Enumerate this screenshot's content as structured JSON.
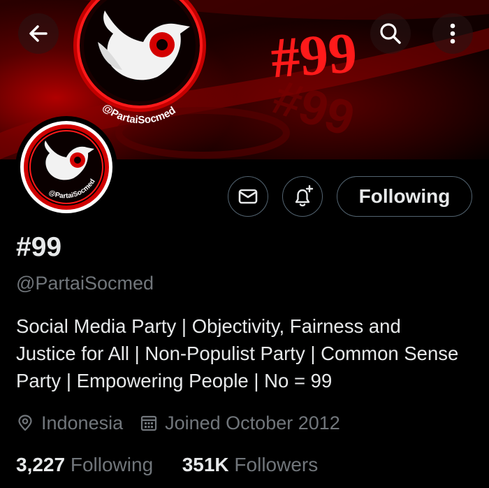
{
  "banner": {
    "hashtag": "#99",
    "echo_text": "#99",
    "logo_caption": "@PartaiSocmed",
    "colors": {
      "accent": "#e00000",
      "dark_red": "#3a0000",
      "background": "#000000"
    }
  },
  "header": {
    "back_icon": "arrow-left-icon",
    "search_icon": "search-icon",
    "more_icon": "more-vertical-icon"
  },
  "avatar": {
    "logo_caption": "@PartaiSocmed"
  },
  "actions": {
    "message_icon": "mail-icon",
    "notify_icon": "bell-plus-icon",
    "following_label": "Following"
  },
  "profile": {
    "display_name": "#99",
    "handle": "@PartaiSocmed",
    "bio": "Social Media Party | Objectivity, Fairness and Justice for All | Non-Populist Party | Common Sense Party | Empowering People | No = 99",
    "location": "Indonesia",
    "location_icon": "location-pin-icon",
    "joined": "Joined October 2012",
    "joined_icon": "calendar-icon"
  },
  "stats": {
    "following_count": "3,227",
    "following_label": "Following",
    "followers_count": "351K",
    "followers_label": "Followers"
  },
  "colors": {
    "text": "#e7e9ea",
    "muted": "#71767b",
    "border": "#536471"
  }
}
